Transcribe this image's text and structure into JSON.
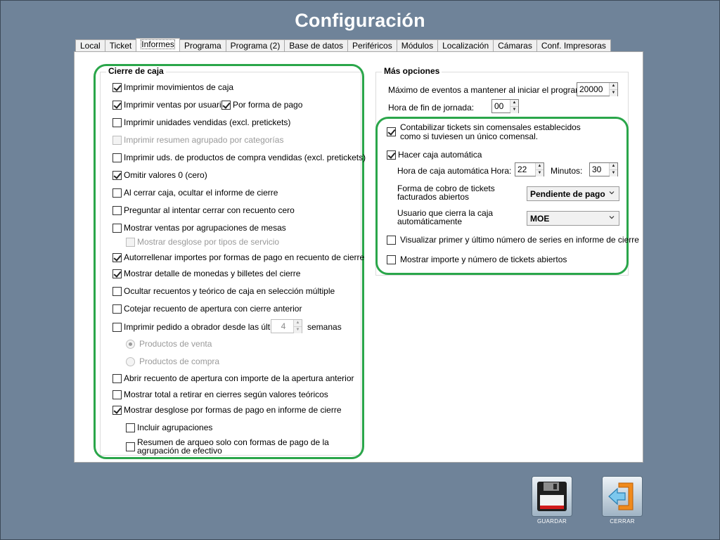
{
  "title": "Configuración",
  "tabs": [
    "Local",
    "Ticket",
    "Informes",
    "Programa",
    "Programa (2)",
    "Base de datos",
    "Periféricos",
    "Módulos",
    "Localización",
    "Cámaras",
    "Conf. Impresoras"
  ],
  "cierre": {
    "title": "Cierre de caja",
    "items": {
      "imprimir_movimientos": "Imprimir movimientos de caja",
      "imprimir_ventas_usuario": "Imprimir ventas por usuario",
      "por_forma_pago": "Por forma de pago",
      "imprimir_unidades": "Imprimir unidades vendidas (excl. pretickets)",
      "imprimir_resumen": "Imprimir resumen agrupado por categorías",
      "imprimir_uds_compra": "Imprimir uds. de productos de compra vendidas (excl. pretickets)",
      "omitir_valores": "Omitir valores 0 (cero)",
      "al_cerrar": "Al cerrar caja, ocultar el informe de cierre",
      "preguntar": "Preguntar al intentar cerrar con recuento cero",
      "mostrar_ventas_mesas": "Mostrar ventas por agrupaciones de mesas",
      "mostrar_desglose_servicio": "Mostrar desglose por tipos de servicio",
      "autorrellenar": "Autorrellenar importes por formas de pago en recuento de cierre",
      "mostrar_detalle_monedas": "Mostrar detalle de monedas y billetes del cierre",
      "ocultar_recuentos": "Ocultar recuentos y teórico de caja en selección múltiple",
      "cotejar": "Cotejar recuento de apertura con cierre anterior",
      "imprimir_pedido": "Imprimir pedido a obrador desde las últimas",
      "semanas_value": "4",
      "semanas": "semanas",
      "productos_venta": "Productos de venta",
      "productos_compra": "Productos de compra",
      "abrir_recuento": "Abrir recuento de apertura con importe de la apertura anterior",
      "mostrar_total": "Mostrar total a retirar en cierres según valores teóricos",
      "mostrar_desglose_formas": "Mostrar desglose por formas de pago en informe de cierre",
      "incluir_agrupaciones": "Incluir agrupaciones",
      "resumen_arqueo": "Resumen de arqueo solo con formas de pago de la agrupación de efectivo"
    }
  },
  "mas": {
    "title": "Más opciones",
    "max_eventos_label": "Máximo de eventos a mantener al iniciar el programa:",
    "max_eventos_value": "20000",
    "hora_fin_label": "Hora de fin de jornada:",
    "hora_fin_value": "00",
    "contabilizar": "Contabilizar tickets sin comensales establecidos como si tuviesen un único comensal.",
    "hacer_caja": "Hacer caja automática",
    "hora_caja_label": "Hora de caja automática",
    "hora_label": "Hora:",
    "hora_value": "22",
    "minutos_label": "Minutos:",
    "minutos_value": "30",
    "forma_cobro_label": "Forma de cobro de tickets facturados abiertos",
    "forma_cobro_value": "Pendiente de pago",
    "usuario_label": "Usuario que cierra la caja automáticamente",
    "usuario_value": "MOE",
    "visualizar": "Visualizar primer y último número de series en informe de cierre",
    "mostrar_importe": "Mostrar importe y número de tickets abiertos"
  },
  "buttons": {
    "guardar": "GUARDAR",
    "cerrar": "CERRAR"
  }
}
